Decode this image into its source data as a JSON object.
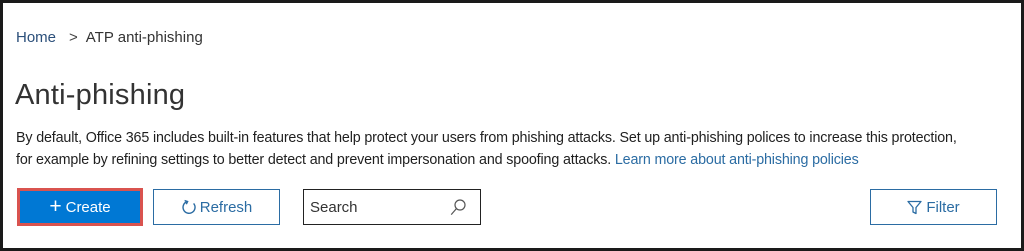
{
  "breadcrumb": {
    "home": "Home",
    "separator": ">",
    "current": "ATP anti-phishing"
  },
  "page_title": "Anti-phishing",
  "description": {
    "line1": "By default, Office 365 includes built-in features that help protect your users from phishing attacks. Set up anti-phishing polices to increase this protection,",
    "line2": "for example by refining settings to better detect and prevent impersonation and spoofing attacks.",
    "link": "Learn more about anti-phishing policies"
  },
  "toolbar": {
    "create_icon": "+",
    "create_label": "Create",
    "refresh_label": "Refresh",
    "refresh_icon": "refresh-icon",
    "search_placeholder": "Search",
    "search_icon": "search-icon",
    "filter_label": "Filter",
    "filter_icon": "filter-icon"
  },
  "colors": {
    "accent": "#0078d4",
    "link": "#2b6ca3",
    "highlight_border": "#d9534f"
  }
}
